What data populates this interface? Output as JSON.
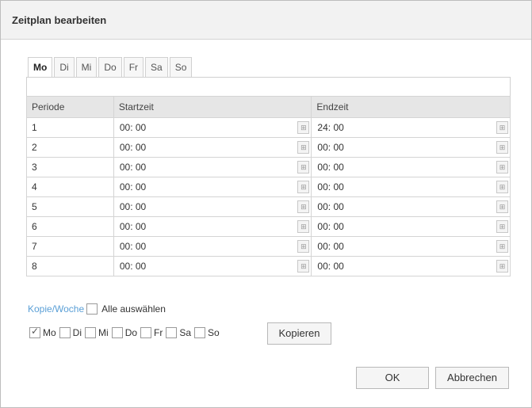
{
  "dialog": {
    "title": "Zeitplan bearbeiten"
  },
  "tabs": [
    {
      "label": "Mo",
      "active": true
    },
    {
      "label": "Di",
      "active": false
    },
    {
      "label": "Mi",
      "active": false
    },
    {
      "label": "Do",
      "active": false
    },
    {
      "label": "Fr",
      "active": false
    },
    {
      "label": "Sa",
      "active": false
    },
    {
      "label": "So",
      "active": false
    }
  ],
  "table": {
    "headers": {
      "period": "Periode",
      "start": "Startzeit",
      "end": "Endzeit"
    },
    "rows": [
      {
        "period": "1",
        "start": "00: 00",
        "end": "24: 00"
      },
      {
        "period": "2",
        "start": "00: 00",
        "end": "00: 00"
      },
      {
        "period": "3",
        "start": "00: 00",
        "end": "00: 00"
      },
      {
        "period": "4",
        "start": "00: 00",
        "end": "00: 00"
      },
      {
        "period": "5",
        "start": "00: 00",
        "end": "00: 00"
      },
      {
        "period": "6",
        "start": "00: 00",
        "end": "00: 00"
      },
      {
        "period": "7",
        "start": "00: 00",
        "end": "00: 00"
      },
      {
        "period": "8",
        "start": "00: 00",
        "end": "00: 00"
      }
    ]
  },
  "copy": {
    "link_label": "Kopie/Woche",
    "select_all_label": "Alle auswählen",
    "select_all_checked": false,
    "days": [
      {
        "label": "Mo",
        "checked": true
      },
      {
        "label": "Di",
        "checked": false
      },
      {
        "label": "Mi",
        "checked": false
      },
      {
        "label": "Do",
        "checked": false
      },
      {
        "label": "Fr",
        "checked": false
      },
      {
        "label": "Sa",
        "checked": false
      },
      {
        "label": "So",
        "checked": false
      }
    ],
    "copy_button_label": "Kopieren"
  },
  "footer": {
    "ok_label": "OK",
    "cancel_label": "Abbrechen"
  },
  "colors": {
    "link": "#5a9fd6",
    "header_bg": "#e6e6e6",
    "title_bg": "#f2f2f2"
  }
}
